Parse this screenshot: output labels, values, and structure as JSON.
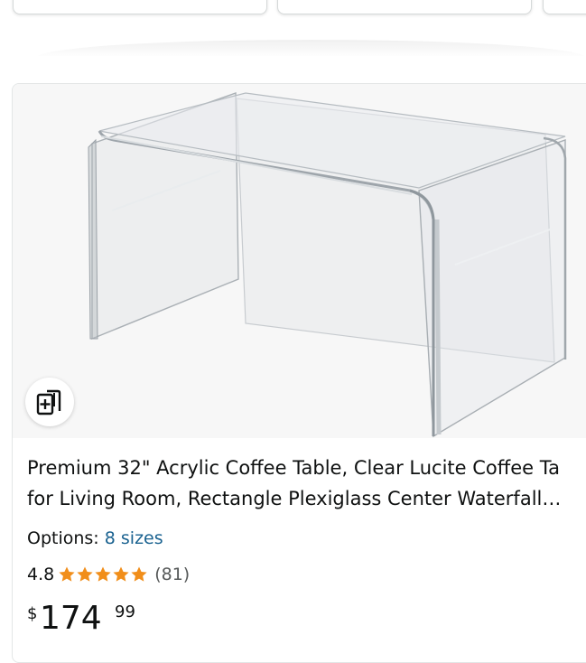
{
  "product": {
    "title_line1": "Premium 32\" Acrylic Coffee Table, Clear Lucite Coffee Ta",
    "title_line2": "for Living Room, Rectangle Plexiglass Center Waterfall…",
    "options_label": "Options:",
    "options_value": "8 sizes",
    "rating": "4.8",
    "rating_count": "(81)",
    "stars_filled": 4.8,
    "stars_total": 5,
    "price_symbol": "$",
    "price_whole": "174",
    "price_fraction": "99"
  },
  "icons": {
    "compare": "compare-cards-icon",
    "star": "star-icon"
  },
  "colors": {
    "link": "#1a6290",
    "star": "#f18e1a",
    "image_bg": "#f7f7f7"
  }
}
